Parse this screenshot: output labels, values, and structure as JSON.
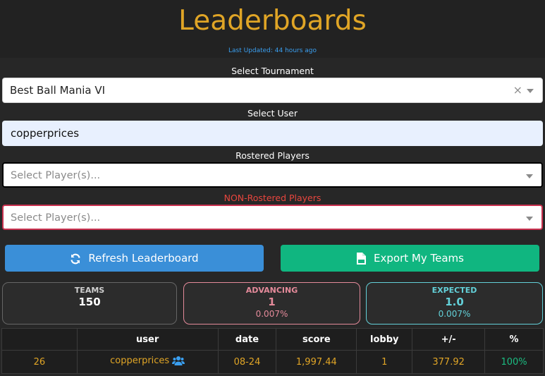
{
  "header": {
    "title": "Leaderboards",
    "last_updated": "Last Updated: 44 hours ago"
  },
  "tournament": {
    "label": "Select Tournament",
    "value": "Best Ball Mania VI",
    "clear_symbol": "×"
  },
  "user": {
    "label": "Select User",
    "value": "copperprices"
  },
  "rostered": {
    "label": "Rostered Players",
    "placeholder": "Select Player(s)..."
  },
  "non_rostered": {
    "label": "NON-Rostered Players",
    "placeholder": "Select Player(s)..."
  },
  "buttons": {
    "refresh": "Refresh Leaderboard",
    "export": "Export My Teams"
  },
  "stats": {
    "teams": {
      "label": "TEAMS",
      "value": "150"
    },
    "advancing": {
      "label": "ADVANCING",
      "value": "1",
      "pct": "0.007%"
    },
    "expected": {
      "label": "EXPECTED",
      "value": "1.0",
      "pct": "0.007%"
    }
  },
  "table": {
    "headers": [
      "",
      "user",
      "date",
      "score",
      "lobby",
      "+/-",
      "%"
    ],
    "rows": [
      {
        "rank": "26",
        "user": "copperprices",
        "date": "08-24",
        "score": "1,997.44",
        "lobby": "1",
        "diff": "377.92",
        "pct": "100%"
      }
    ]
  },
  "colors": {
    "accent": "#e0a526",
    "link": "#3a9ff0",
    "refresh_button": "#3a8fd8",
    "export_button": "#10b680",
    "advancing": "#e48a9a",
    "expected": "#63d0d8",
    "non_rostered_label": "#e8463e"
  },
  "icons": {
    "refresh": "refresh-icon",
    "export": "csv-file-icon",
    "clear": "clear-icon",
    "dropdown": "chevron-down-icon",
    "users": "users-icon"
  }
}
